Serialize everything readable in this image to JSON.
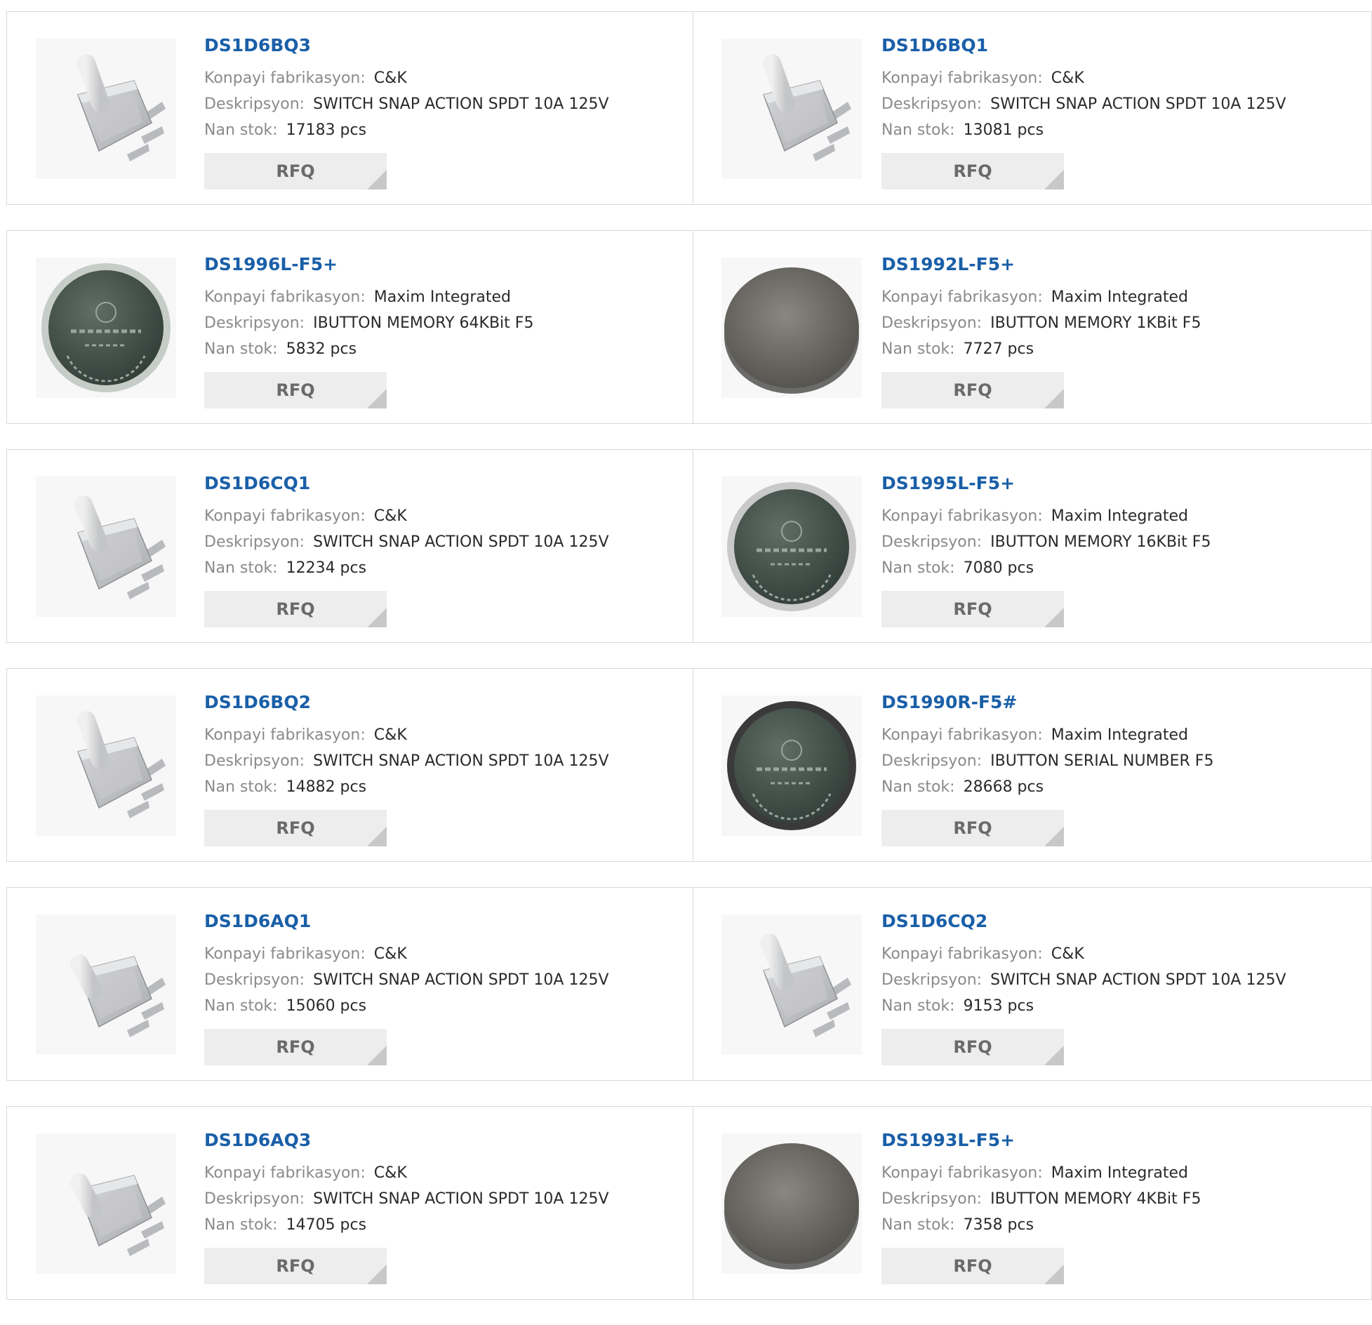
{
  "labels": {
    "manufacturer": "Konpayi fabrikasyon:",
    "description": "Deskripsyon:",
    "stock": "Nan stok:",
    "rfq": "RFQ"
  },
  "colors": {
    "part_link": "#1a5fa8",
    "label": "#8a8a8a",
    "value": "#2a2a2a",
    "rfq_bg": "#ededed",
    "border": "#d9d9d9"
  },
  "products": [
    {
      "part": "DS1D6BQ3",
      "manufacturer": "C&K",
      "description": "SWITCH SNAP ACTION SPDT 10A 125V",
      "stock": "17183 pcs",
      "image": "snap-switch"
    },
    {
      "part": "DS1D6BQ1",
      "manufacturer": "C&K",
      "description": "SWITCH SNAP ACTION SPDT 10A 125V",
      "stock": "13081 pcs",
      "image": "snap-switch"
    },
    {
      "part": "DS1996L-F5+",
      "manufacturer": "Maxim Integrated",
      "description": "IBUTTON MEMORY 64KBit F5",
      "stock": "5832 pcs",
      "image": "ibutton-green"
    },
    {
      "part": "DS1992L-F5+",
      "manufacturer": "Maxim Integrated",
      "description": "IBUTTON MEMORY 1KBit F5",
      "stock": "7727 pcs",
      "image": "ibutton-cap-gray"
    },
    {
      "part": "DS1D6CQ1",
      "manufacturer": "C&K",
      "description": "SWITCH SNAP ACTION SPDT 10A 125V",
      "stock": "12234 pcs",
      "image": "snap-switch-tall"
    },
    {
      "part": "DS1995L-F5+",
      "manufacturer": "Maxim Integrated",
      "description": "IBUTTON MEMORY 16KBit F5",
      "stock": "7080 pcs",
      "image": "ibutton-dark"
    },
    {
      "part": "DS1D6BQ2",
      "manufacturer": "C&K",
      "description": "SWITCH SNAP ACTION SPDT 10A 125V",
      "stock": "14882 pcs",
      "image": "snap-switch"
    },
    {
      "part": "DS1990R-F5#",
      "manufacturer": "Maxim Integrated",
      "description": "IBUTTON SERIAL NUMBER F5",
      "stock": "28668 pcs",
      "image": "ibutton-silver"
    },
    {
      "part": "DS1D6AQ1",
      "manufacturer": "C&K",
      "description": "SWITCH SNAP ACTION SPDT 10A 125V",
      "stock": "15060 pcs",
      "image": "snap-switch-short"
    },
    {
      "part": "DS1D6CQ2",
      "manufacturer": "C&K",
      "description": "SWITCH SNAP ACTION SPDT 10A 125V",
      "stock": "9153 pcs",
      "image": "snap-switch-tall"
    },
    {
      "part": "DS1D6AQ3",
      "manufacturer": "C&K",
      "description": "SWITCH SNAP ACTION SPDT 10A 125V",
      "stock": "14705 pcs",
      "image": "snap-switch-short"
    },
    {
      "part": "DS1993L-F5+",
      "manufacturer": "Maxim Integrated",
      "description": "IBUTTON MEMORY 4KBit F5",
      "stock": "7358 pcs",
      "image": "ibutton-cap-dark"
    }
  ]
}
